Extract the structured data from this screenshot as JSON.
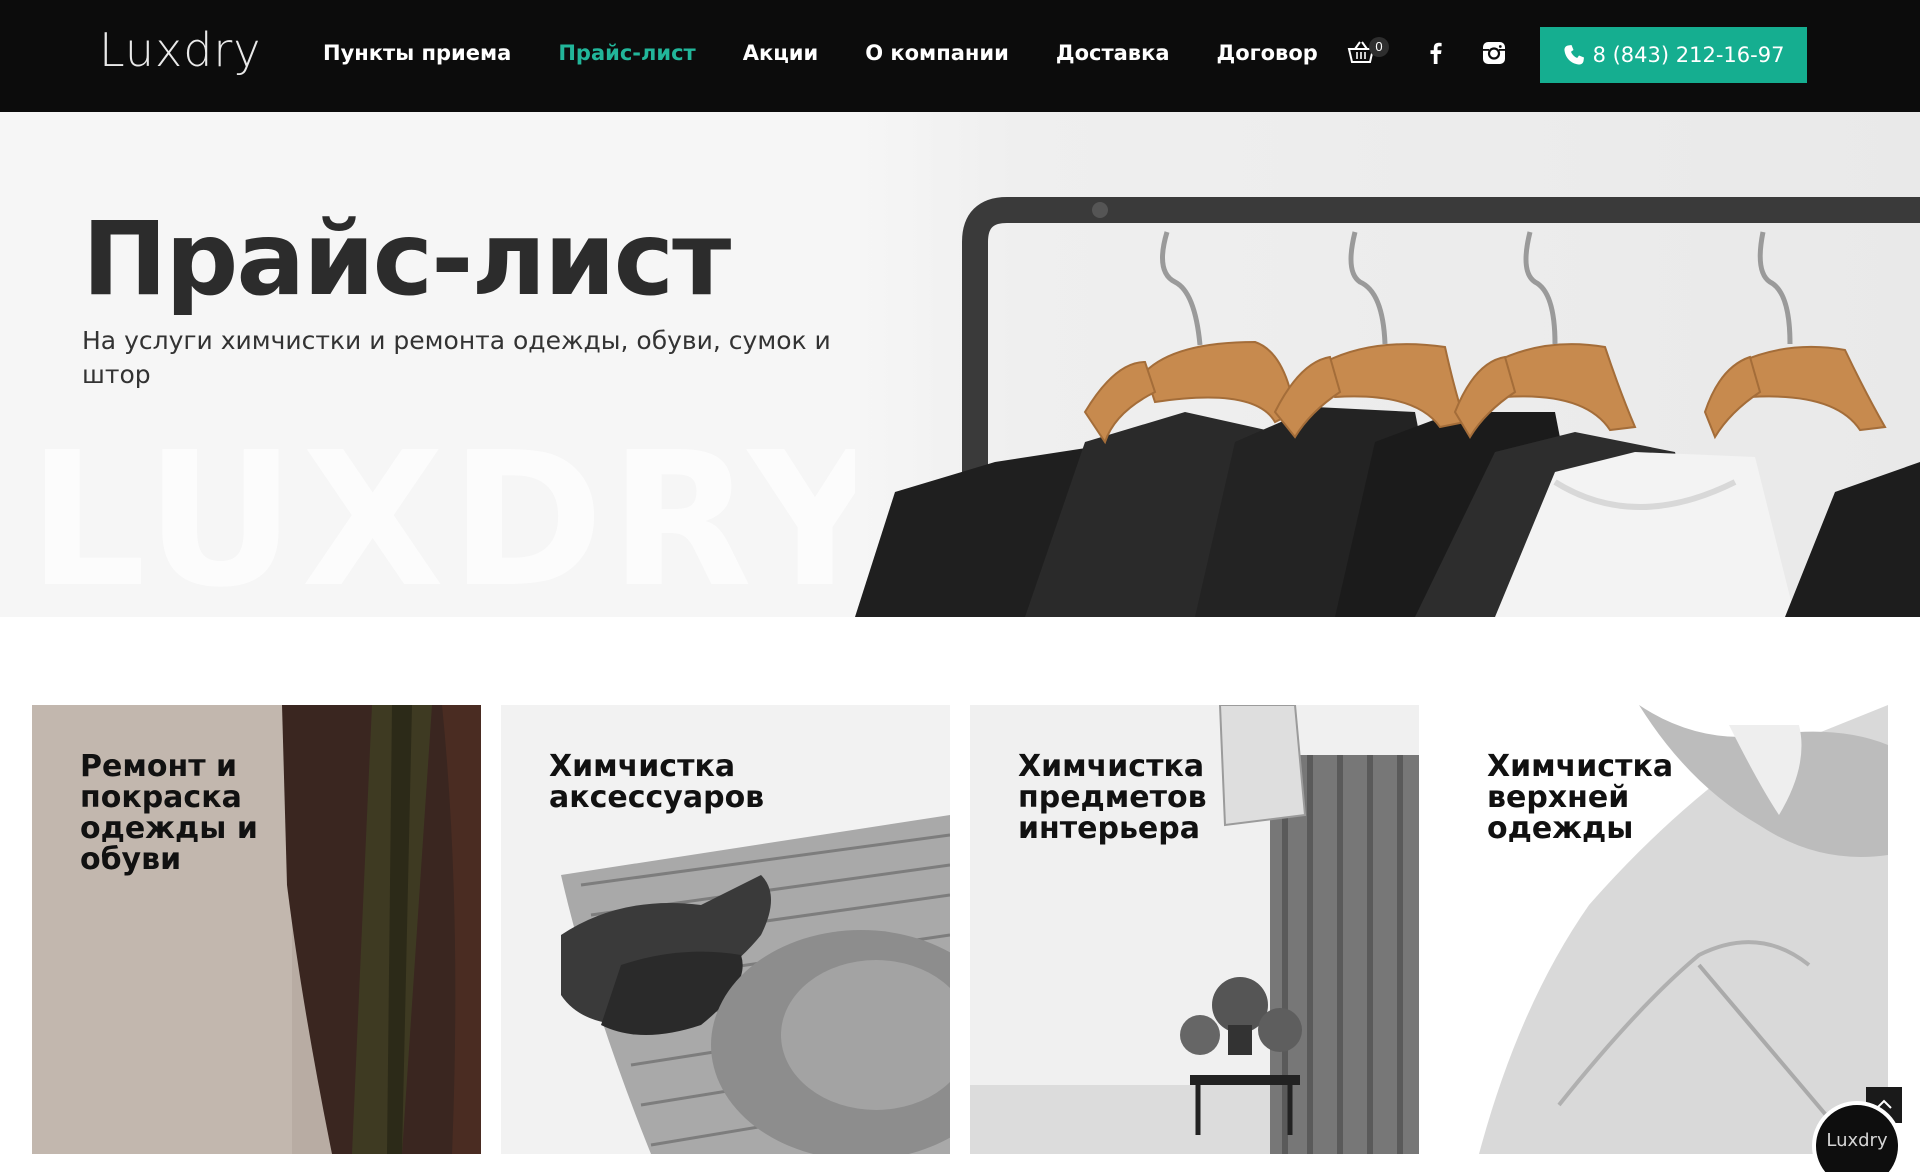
{
  "header": {
    "logo_text": "Luxdry",
    "nav": [
      {
        "label": "Пункты приема",
        "active": false
      },
      {
        "label": "Прайс-лист",
        "active": true
      },
      {
        "label": "Акции",
        "active": false
      },
      {
        "label": "О компании",
        "active": false
      },
      {
        "label": "Доставка",
        "active": false
      },
      {
        "label": "Договор",
        "active": false
      }
    ],
    "cart_count": "0",
    "phone": "8 (843) 212-16-97",
    "icons": [
      "cart-icon",
      "facebook-icon",
      "instagram-icon",
      "phone-icon"
    ]
  },
  "hero": {
    "title": "Прайс-лист",
    "subtitle": "На услуги химчистки и ремонта одежды, обуви, сумок и штор",
    "watermark": "LUXDRY"
  },
  "cards": [
    {
      "title": "Ремонт и покраска одежды и обуви"
    },
    {
      "title": "Химчистка аксессуаров"
    },
    {
      "title": "Химчистка предметов интерьера"
    },
    {
      "title": "Химчистка верхней одежды"
    }
  ],
  "chat_badge": "Luxdry",
  "colors": {
    "accent": "#15ae90",
    "active_nav": "#22b69a",
    "header_bg": "#0c0c0c"
  }
}
